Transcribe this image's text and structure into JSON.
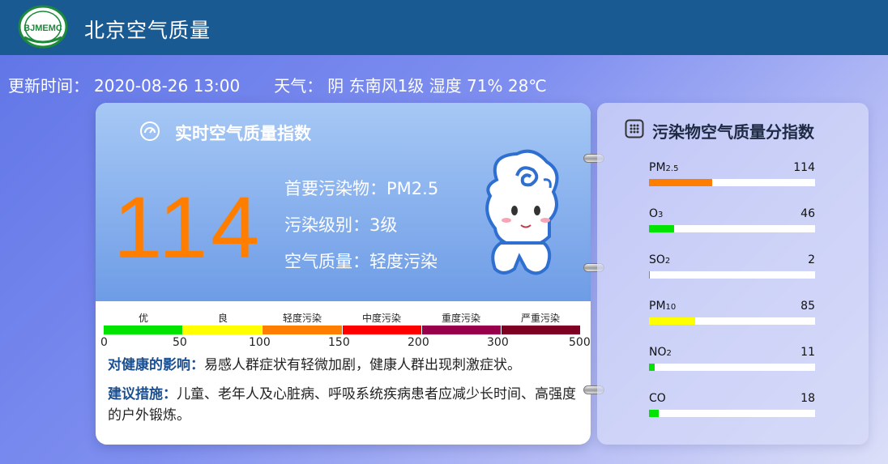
{
  "header": {
    "logo_text": "BJMEMC",
    "title": "北京空气质量"
  },
  "info": {
    "update_label": "更新时间：",
    "update_time": "2020-08-26 13:00",
    "weather_label": "天气：",
    "weather_value": "阴 东南风1级 湿度 71% 28℃"
  },
  "aqi_card": {
    "title": "实时空气质量指数",
    "aqi_value": "114",
    "primary_pollutant": "首要污染物：PM2.5",
    "pollution_level": "污染级别：3级",
    "air_quality": "空气质量：轻度污染",
    "scale": {
      "categories": [
        "优",
        "良",
        "轻度污染",
        "中度污染",
        "重度污染",
        "严重污染"
      ],
      "colors": [
        "#00e400",
        "#ffff00",
        "#ff7e00",
        "#ff0000",
        "#99004c",
        "#7e0023"
      ],
      "ticks": [
        "0",
        "50",
        "100",
        "150",
        "200",
        "300",
        "500"
      ]
    },
    "health_label": "对健康的影响：",
    "health_text": "易感人群症状有轻微加剧，健康人群出现刺激症状。",
    "advice_label": "建议措施：",
    "advice_text": "儿童、老年人及心脏病、呼吸系统疾病患者应减少长时间、高强度的户外锻炼。"
  },
  "pollutants": {
    "title": "污染物空气质量分指数",
    "items": [
      {
        "name": "PM",
        "sub": "2.5",
        "value": "114",
        "level": 0.38,
        "color": "#ff7e00"
      },
      {
        "name": "O",
        "sub": "3",
        "value": "46",
        "level": 0.15,
        "color": "#00e400"
      },
      {
        "name": "SO",
        "sub": "2",
        "value": "2",
        "level": 0.006,
        "color": "#00e400"
      },
      {
        "name": "PM",
        "sub": "10",
        "value": "85",
        "level": 0.28,
        "color": "#ffff00"
      },
      {
        "name": "NO",
        "sub": "2",
        "value": "11",
        "level": 0.035,
        "color": "#00e400"
      },
      {
        "name": "CO",
        "sub": "",
        "value": "18",
        "level": 0.06,
        "color": "#00e400"
      }
    ]
  }
}
